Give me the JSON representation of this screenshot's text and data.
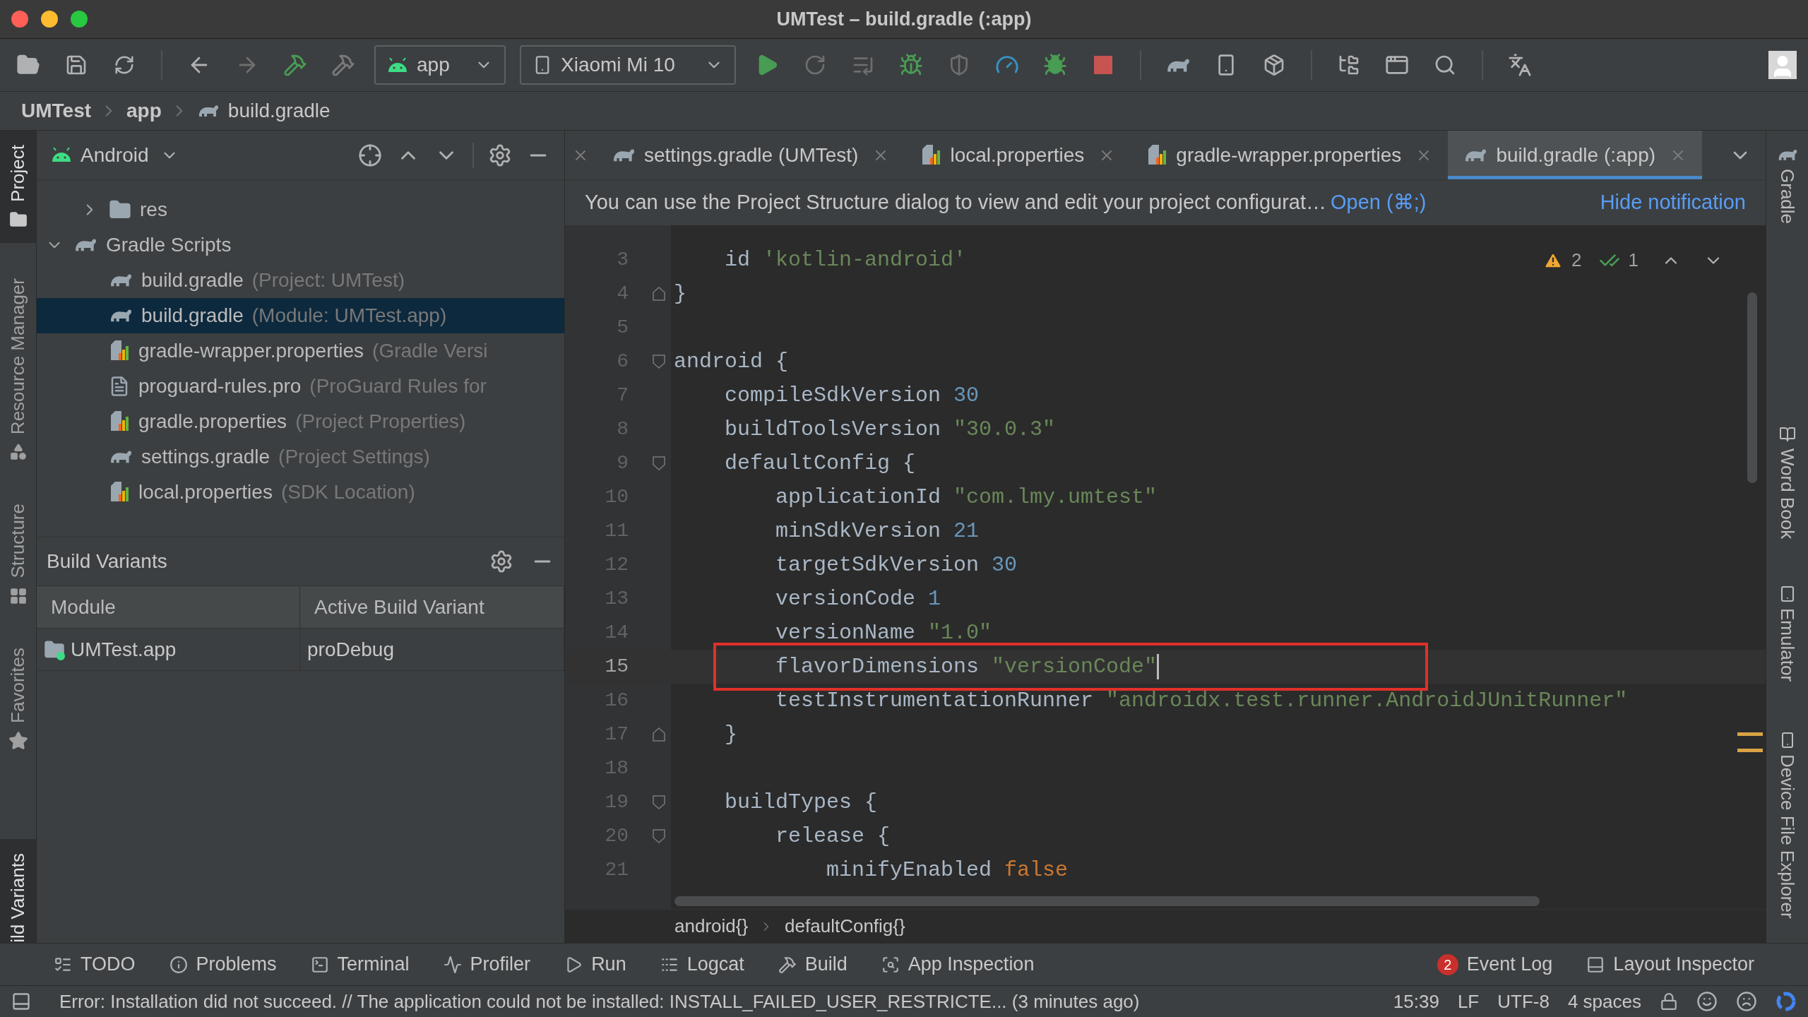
{
  "window": {
    "title": "UMTest – build.gradle (:app)"
  },
  "toolbar": {
    "run_config": "app",
    "device": "Xiaomi Mi 10"
  },
  "breadcrumb": [
    "UMTest",
    "app",
    "build.gradle"
  ],
  "left_strip": [
    {
      "label": "Project",
      "selected": true
    },
    {
      "label": "Resource Manager",
      "selected": false
    },
    {
      "label": "Structure",
      "selected": false
    },
    {
      "label": "Favorites",
      "selected": false
    },
    {
      "label": "ild Variants",
      "selected": true
    }
  ],
  "project_panel": {
    "view": "Android",
    "tree": [
      {
        "name": "res",
        "kind": "folder",
        "expanded": false,
        "selected": false
      },
      {
        "name": "Gradle Scripts",
        "kind": "gradle",
        "expanded": true,
        "selected": false,
        "children": [
          {
            "name": "build.gradle",
            "hint": "(Project: UMTest)",
            "kind": "gradle",
            "selected": false
          },
          {
            "name": "build.gradle",
            "hint": "(Module: UMTest.app)",
            "kind": "gradle",
            "selected": true
          },
          {
            "name": "gradle-wrapper.properties",
            "hint": "(Gradle Versi",
            "kind": "properties",
            "selected": false
          },
          {
            "name": "proguard-rules.pro",
            "hint": "(ProGuard Rules for",
            "kind": "text",
            "selected": false
          },
          {
            "name": "gradle.properties",
            "hint": "(Project Properties)",
            "kind": "properties",
            "selected": false
          },
          {
            "name": "settings.gradle",
            "hint": "(Project Settings)",
            "kind": "gradle",
            "selected": false
          },
          {
            "name": "local.properties",
            "hint": "(SDK Location)",
            "kind": "properties",
            "selected": false
          }
        ]
      }
    ]
  },
  "build_variants": {
    "title": "Build Variants",
    "columns": [
      "Module",
      "Active Build Variant"
    ],
    "rows": [
      [
        "UMTest.app",
        "proDebug"
      ]
    ]
  },
  "editor": {
    "tabs": [
      {
        "label": "settings.gradle (UMTest)",
        "kind": "gradle",
        "selected": false
      },
      {
        "label": "local.properties",
        "kind": "properties",
        "selected": false
      },
      {
        "label": "gradle-wrapper.properties",
        "kind": "properties",
        "selected": false
      },
      {
        "label": "build.gradle (:app)",
        "kind": "gradle",
        "selected": true
      }
    ],
    "notification": {
      "text": "You can use the Project Structure dialog to view and edit your project configurat…",
      "action": "Open (⌘;)",
      "dismiss": "Hide notification"
    },
    "inspections": {
      "warnings": "2",
      "passed": "1"
    },
    "lines": [
      {
        "number": "3",
        "current": false,
        "boxed": false,
        "kind": "plain",
        "tokens": [
          {
            "kind": "plain",
            "text": "    id "
          },
          {
            "kind": "string",
            "text": "'kotlin-android'"
          }
        ]
      },
      {
        "number": "4",
        "current": false,
        "boxed": false,
        "kind": "fold-end",
        "tokens": [
          {
            "kind": "plain",
            "text": "}"
          }
        ]
      },
      {
        "number": "5",
        "current": false,
        "boxed": false,
        "kind": "plain"
      },
      {
        "number": "6",
        "current": false,
        "boxed": false,
        "kind": "fold-start",
        "tokens": [
          {
            "kind": "plain",
            "text": "android {"
          }
        ]
      },
      {
        "number": "7",
        "current": false,
        "boxed": false,
        "kind": "plain",
        "tokens": [
          {
            "kind": "plain",
            "text": "    compileSdkVersion "
          },
          {
            "kind": "number",
            "text": "30"
          }
        ]
      },
      {
        "number": "8",
        "current": false,
        "boxed": false,
        "kind": "plain",
        "tokens": [
          {
            "kind": "plain",
            "text": "    buildToolsVersion "
          },
          {
            "kind": "string",
            "text": "\"30.0.3\""
          }
        ]
      },
      {
        "number": "9",
        "current": false,
        "boxed": false,
        "kind": "fold-start",
        "tokens": [
          {
            "kind": "plain",
            "text": "    defaultConfig {"
          }
        ]
      },
      {
        "number": "10",
        "current": false,
        "boxed": false,
        "kind": "plain",
        "tokens": [
          {
            "kind": "plain",
            "text": "        applicationId "
          },
          {
            "kind": "string",
            "text": "\"com.lmy.umtest\""
          }
        ]
      },
      {
        "number": "11",
        "current": false,
        "boxed": false,
        "kind": "plain",
        "tokens": [
          {
            "kind": "plain",
            "text": "        minSdkVersion "
          },
          {
            "kind": "number",
            "text": "21"
          }
        ]
      },
      {
        "number": "12",
        "current": false,
        "boxed": false,
        "kind": "plain",
        "tokens": [
          {
            "kind": "plain",
            "text": "        targetSdkVersion "
          },
          {
            "kind": "number",
            "text": "30"
          }
        ]
      },
      {
        "number": "13",
        "current": false,
        "boxed": false,
        "kind": "plain",
        "tokens": [
          {
            "kind": "plain",
            "text": "        versionCode "
          },
          {
            "kind": "number",
            "text": "1"
          }
        ]
      },
      {
        "number": "14",
        "current": false,
        "boxed": false,
        "kind": "plain",
        "tokens": [
          {
            "kind": "plain",
            "text": "        versionName "
          },
          {
            "kind": "string",
            "text": "\"1.0\""
          }
        ]
      },
      {
        "number": "15",
        "current": true,
        "boxed": true,
        "kind": "plain",
        "tokens": [
          {
            "kind": "plain",
            "text": "        flavorDimensions "
          },
          {
            "kind": "string",
            "text": "\"versionCode\""
          }
        ]
      },
      {
        "number": "16",
        "current": false,
        "boxed": false,
        "kind": "plain",
        "tokens": [
          {
            "kind": "plain",
            "text": "        testInstrumentationRunner "
          },
          {
            "kind": "string",
            "text": "\"androidx.test.runner.AndroidJUnitRunner\""
          }
        ]
      },
      {
        "number": "17",
        "current": false,
        "boxed": false,
        "kind": "fold-end",
        "tokens": [
          {
            "kind": "plain",
            "text": "    }"
          }
        ]
      },
      {
        "number": "18",
        "current": false,
        "boxed": false,
        "kind": "plain"
      },
      {
        "number": "19",
        "current": false,
        "boxed": false,
        "kind": "fold-start",
        "tokens": [
          {
            "kind": "plain",
            "text": "    buildTypes {"
          }
        ]
      },
      {
        "number": "20",
        "current": false,
        "boxed": false,
        "kind": "fold-start",
        "tokens": [
          {
            "kind": "plain",
            "text": "        release {"
          }
        ]
      },
      {
        "number": "21",
        "current": false,
        "boxed": false,
        "kind": "plain",
        "tokens": [
          {
            "kind": "plain",
            "text": "            minifyEnabled "
          },
          {
            "kind": "keyword",
            "text": "false"
          }
        ]
      }
    ],
    "breadcrumb": [
      "android{}",
      "defaultConfig{}"
    ]
  },
  "right_strip": [
    "Gradle",
    "Word Book",
    "Emulator",
    "Device File Explorer"
  ],
  "tool_windows": [
    {
      "label": "TODO"
    },
    {
      "label": "Problems"
    },
    {
      "label": "Terminal"
    },
    {
      "label": "Profiler"
    },
    {
      "label": "Run"
    },
    {
      "label": "Logcat"
    },
    {
      "label": "Build"
    },
    {
      "label": "App Inspection"
    }
  ],
  "tool_windows_right": [
    {
      "label": "Event Log",
      "badge": "2"
    },
    {
      "label": "Layout Inspector"
    }
  ],
  "status": {
    "message": "Error: Installation did not succeed. // The application could not be installed: INSTALL_FAILED_USER_RESTRICTE... (3 minutes ago)",
    "items": [
      "15:39",
      "LF",
      "UTF-8",
      "4 spaces"
    ]
  }
}
